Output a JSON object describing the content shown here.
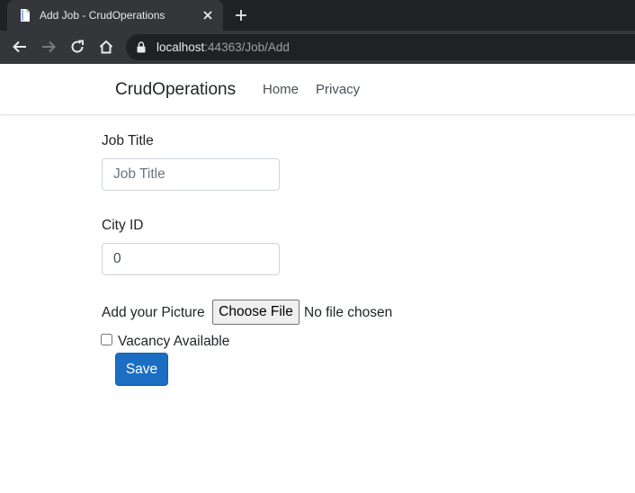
{
  "browser": {
    "tab_title": "Add Job - CrudOperations",
    "url_host": "localhost",
    "url_rest": ":44363/Job/Add"
  },
  "navbar": {
    "brand": "CrudOperations",
    "links": [
      "Home",
      "Privacy"
    ]
  },
  "form": {
    "job_title_label": "Job Title",
    "job_title_placeholder": "Job Title",
    "city_id_label": "City ID",
    "city_id_value": "0",
    "picture_label": "Add your Picture",
    "choose_file_label": "Choose File",
    "no_file_text": "No file chosen",
    "vacancy_label": "Vacancy Available",
    "vacancy_checked": false,
    "save_label": "Save"
  },
  "colors": {
    "chrome_dark": "#202124",
    "chrome_tab": "#35363a",
    "primary_button": "#1b6ec2"
  },
  "icons": [
    "document-icon",
    "close-icon",
    "plus-icon",
    "back-arrow-icon",
    "forward-arrow-icon",
    "reload-icon",
    "home-icon",
    "lock-icon"
  ]
}
